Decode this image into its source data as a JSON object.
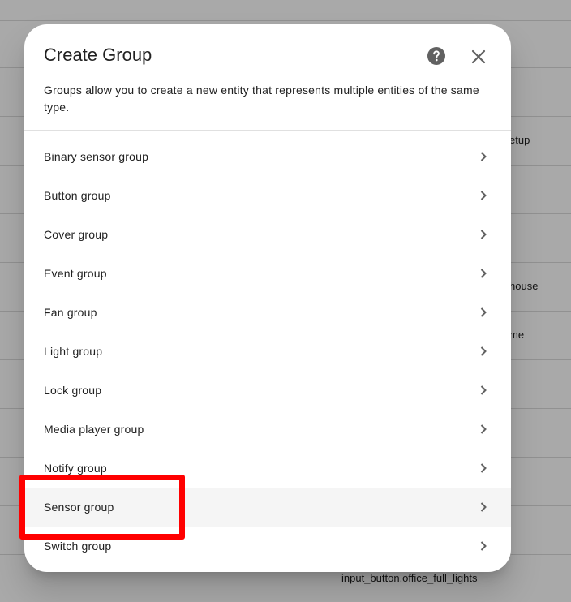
{
  "background": {
    "texts": [
      "etup",
      "house",
      "me",
      "input_button.office_full_lights"
    ]
  },
  "dialog": {
    "title": "Create Group",
    "description": "Groups allow you to create a new entity that represents multiple entities of the same type.",
    "help_icon": "help-circle-icon",
    "close_icon": "close-icon",
    "items": [
      {
        "label": "Binary sensor group"
      },
      {
        "label": "Button group"
      },
      {
        "label": "Cover group"
      },
      {
        "label": "Event group"
      },
      {
        "label": "Fan group"
      },
      {
        "label": "Light group"
      },
      {
        "label": "Lock group"
      },
      {
        "label": "Media player group"
      },
      {
        "label": "Notify group"
      },
      {
        "label": "Sensor group"
      },
      {
        "label": "Switch group"
      }
    ]
  },
  "colors": {
    "highlight": "#ff0000",
    "hover_row": "#f5f5f5",
    "icon": "#616161"
  }
}
